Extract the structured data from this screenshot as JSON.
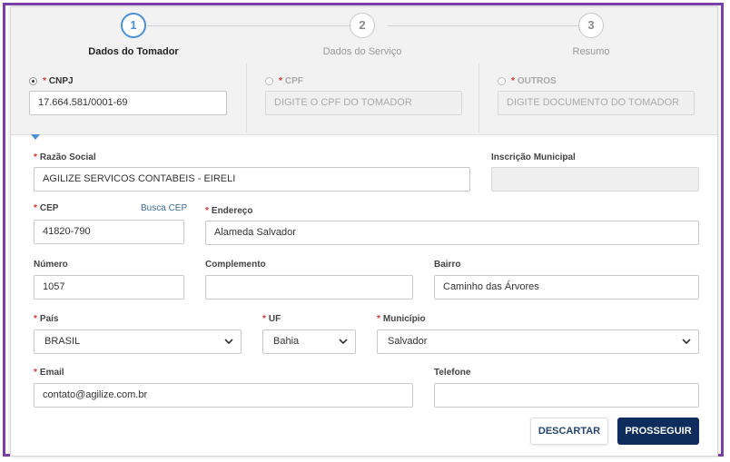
{
  "steps": [
    {
      "number": "1",
      "label": "Dados do Tomador",
      "active": true
    },
    {
      "number": "2",
      "label": "Dados do Serviço",
      "active": false
    },
    {
      "number": "3",
      "label": "Resumo",
      "active": false
    }
  ],
  "documents": {
    "cnpj": {
      "required_mark": "*",
      "label": "CNPJ",
      "value": "17.664.581/0001-69"
    },
    "cpf": {
      "required_mark": "*",
      "label": "CPF",
      "placeholder": "DIGITE O CPF DO TOMADOR"
    },
    "outros": {
      "required_mark": "*",
      "label": "OUTROS",
      "placeholder": "DIGITE DOCUMENTO DO TOMADOR"
    }
  },
  "form": {
    "razao_social": {
      "required_mark": "*",
      "label": "Razão Social",
      "value": "AGILIZE SERVICOS CONTABEIS - EIRELI"
    },
    "inscricao_municipal": {
      "label": "Inscrição Municipal",
      "value": ""
    },
    "cep": {
      "required_mark": "*",
      "label": "CEP",
      "value": "41820-790",
      "link": "Busca CEP"
    },
    "endereco": {
      "required_mark": "*",
      "label": "Endereço",
      "value": "Alameda Salvador"
    },
    "numero": {
      "label": "Número",
      "value": "1057"
    },
    "complemento": {
      "label": "Complemento",
      "value": ""
    },
    "bairro": {
      "label": "Bairro",
      "value": "Caminho das Árvores"
    },
    "pais": {
      "required_mark": "*",
      "label": "País",
      "value": "BRASIL"
    },
    "uf": {
      "required_mark": "*",
      "label": "UF",
      "value": "Bahia"
    },
    "municipio": {
      "required_mark": "*",
      "label": "Município",
      "value": "Salvador"
    },
    "email": {
      "required_mark": "*",
      "label": "Email",
      "value": "contato@agilize.com.br"
    },
    "telefone": {
      "label": "Telefone",
      "value": ""
    }
  },
  "actions": {
    "discard": "DESCARTAR",
    "proceed": "PROSSEGUIR"
  },
  "colors": {
    "accent": "#4a90d9",
    "primary": "#0f2d5c",
    "required": "#d9342b",
    "frame": "#7b3fa8"
  }
}
